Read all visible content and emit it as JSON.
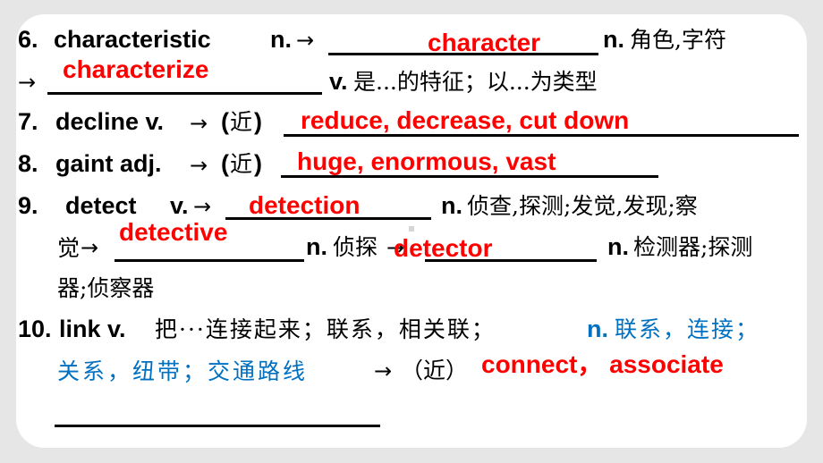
{
  "items": [
    {
      "id": "6",
      "number": "6.",
      "word": "characteristic",
      "pos": "n.",
      "arrow": "→",
      "answer1": "character",
      "answer1_pos": "n.",
      "answer1_meaning": "角色,字符",
      "arrow2": "→",
      "answer2": "characterize",
      "answer2_pos": "v.",
      "answer2_meaning": "是...的特征；以...为类型"
    },
    {
      "id": "7",
      "number": "7.",
      "word": "decline v.",
      "arrow": "→",
      "synonym_label_open": "(",
      "synonym_label": "近",
      "synonym_label_close": ")",
      "answer": "reduce, decrease, cut down"
    },
    {
      "id": "8",
      "number": "8.",
      "word": "gaint adj.",
      "arrow": "→",
      "synonym_label_open": "(",
      "synonym_label": "近",
      "synonym_label_close": ")",
      "answer": "huge, enormous, vast"
    },
    {
      "id": "9",
      "number": "9.",
      "word": "detect",
      "pos": "v.",
      "arrow": "→",
      "answer1": "detection",
      "answer1_pos": "n.",
      "answer1_meaning_a": "侦查,探测;发觉,发现;察",
      "answer1_meaning_b": "觉",
      "arrow2": "→",
      "answer2": "detective",
      "answer2_pos": "n.",
      "answer2_meaning": "侦探",
      "arrow3": "→",
      "answer3": "detector",
      "answer3_pos": "n.",
      "answer3_meaning_a": "检测器;探测",
      "answer3_meaning_b": "器;侦察器"
    },
    {
      "id": "10",
      "number": "10.",
      "word": "link v.",
      "verb_meaning": "把···连接起来；联系，相关联；",
      "noun_pos": "n.",
      "noun_meaning_a": "联系，连接；",
      "noun_meaning_b": "关系，纽带；交通路线",
      "arrow": "→",
      "synonym_label": "（近）",
      "answer": "connect， associate"
    }
  ],
  "colors": {
    "answer": "#ff0000",
    "noun_meaning": "#0070c0",
    "text": "#000000",
    "background": "#e6e6e6",
    "card": "#ffffff"
  }
}
